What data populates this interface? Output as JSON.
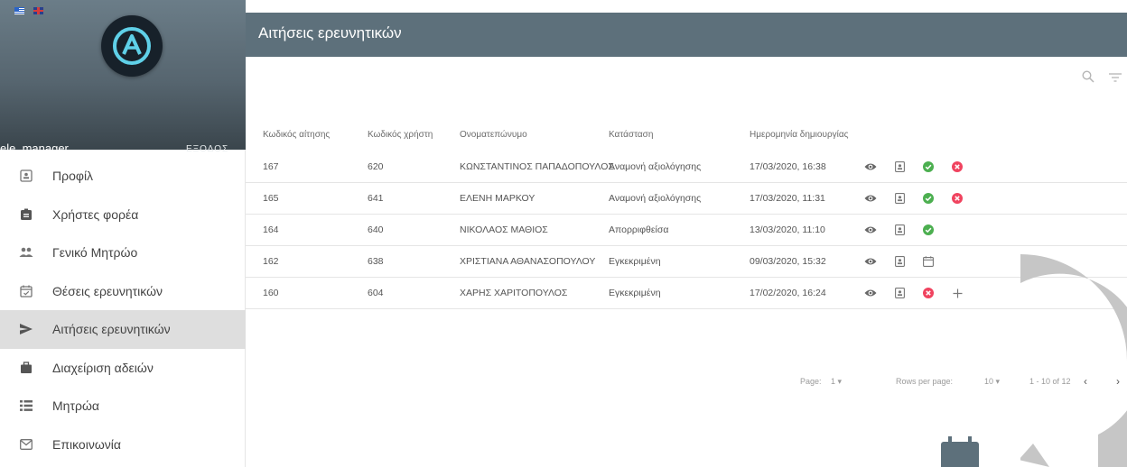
{
  "flags": [
    "greek-flag-icon",
    "english-flag-icon"
  ],
  "sidebar": {
    "username": "ele_manager",
    "logout_label": "ΕΞΟΔΟΣ",
    "items": [
      {
        "label": "Προφίλ",
        "icon": "profile-icon"
      },
      {
        "label": "Χρήστες φορέα",
        "icon": "badge-icon"
      },
      {
        "label": "Γενικό Μητρώο",
        "icon": "people-icon"
      },
      {
        "label": "Θέσεις ερευνητικών",
        "icon": "calendar-check-icon"
      },
      {
        "label": "Αιτήσεις ερευνητικών",
        "icon": "send-icon",
        "active": true
      },
      {
        "label": "Διαχείριση αδειών",
        "icon": "briefcase-icon"
      },
      {
        "label": "Μητρώα",
        "icon": "list-icon"
      },
      {
        "label": "Επικοινωνία",
        "icon": "mail-icon"
      }
    ]
  },
  "header": {
    "title": "Αιτήσεις ερευνητικών"
  },
  "table": {
    "columns": [
      "Κωδικός αίτησης",
      "Κωδικός χρήστη",
      "Ονοματεπώνυμο",
      "Κατάσταση",
      "Ημερομηνία δημιουργίας"
    ],
    "rows": [
      {
        "app_id": "167",
        "user_id": "620",
        "name": "ΚΩΝΣΤΑΝΤΙΝΟΣ ΠΑΠΑΔΟΠΟΥΛΟΣ",
        "status": "Αναμονή αξιολόγησης",
        "created": "17/03/2020, 16:38",
        "actions": [
          "view",
          "profile",
          "approve",
          "reject"
        ]
      },
      {
        "app_id": "165",
        "user_id": "641",
        "name": "ΕΛΕΝΗ ΜΑΡΚΟΥ",
        "status": "Αναμονή αξιολόγησης",
        "created": "17/03/2020, 11:31",
        "actions": [
          "view",
          "profile",
          "approve",
          "reject"
        ]
      },
      {
        "app_id": "164",
        "user_id": "640",
        "name": "ΝΙΚΟΛΑΟΣ ΜΑΘΙΟΣ",
        "status": "Απορριφθείσα",
        "created": "13/03/2020, 11:10",
        "actions": [
          "view",
          "profile",
          "approve"
        ]
      },
      {
        "app_id": "162",
        "user_id": "638",
        "name": "ΧΡΙΣΤΙΑΝΑ ΑΘΑΝΑΣΟΠΟΥΛΟΥ",
        "status": "Εγκεκριμένη",
        "created": "09/03/2020, 15:32",
        "actions": [
          "view",
          "profile",
          "calendar"
        ]
      },
      {
        "app_id": "160",
        "user_id": "604",
        "name": "ΧΑΡΗΣ ΧΑΡΙΤΟΠΟΥΛΟΣ",
        "status": "Εγκεκριμένη",
        "created": "17/02/2020, 16:24",
        "actions": [
          "view",
          "profile",
          "reject",
          "add"
        ]
      }
    ]
  },
  "pager": {
    "page_label": "Page:",
    "page_value": "1",
    "rows_label": "Rows per page:",
    "rows_value": "10",
    "range": "1 - 10 of 12"
  },
  "colors": {
    "accent": "#5d707b",
    "approve": "#4caf50",
    "reject": "#f0435f"
  }
}
